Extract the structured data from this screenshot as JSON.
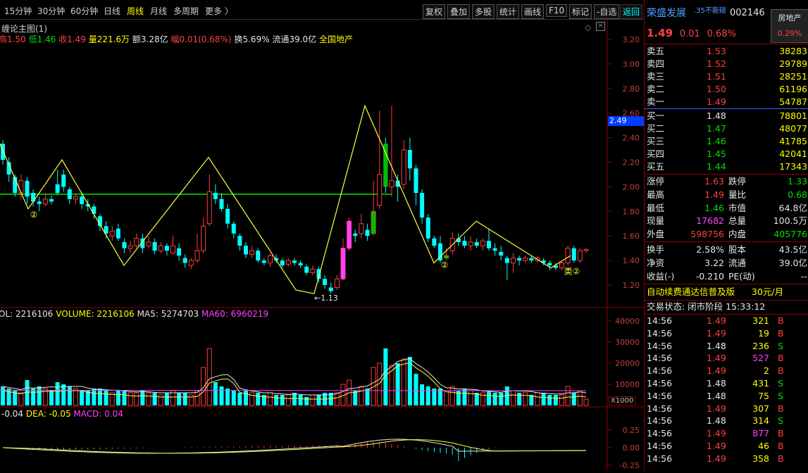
{
  "toolbar": {
    "periods": [
      "15分钟",
      "30分钟",
      "60分钟",
      "日线",
      "周线",
      "月线",
      "多周期",
      "更多 〉"
    ],
    "selected_period": "周线",
    "buttons": [
      "复权",
      "叠加",
      "多股",
      "统计",
      "画线",
      "F10",
      "标记",
      "-自选",
      "返回"
    ]
  },
  "main_chart": {
    "title": "缠论主图(1)",
    "stats": {
      "high": "高1.50",
      "low": "低1.46",
      "close": "收1.49",
      "volume": "量221.6万",
      "amount": "额3.28亿",
      "change": "幅0.01(0.68%)",
      "turnover": "换5.69%",
      "float": "流通39.0亿",
      "sector": "全国地产"
    },
    "price_axis": [
      "3.20",
      "3.00",
      "2.80",
      "2.60",
      "2.40",
      "2.20",
      "2.00",
      "1.80",
      "1.60",
      "1.40",
      "1.20"
    ],
    "current_price_tag": "2.49",
    "low_label": "1.13",
    "markers": [
      "②",
      "②",
      "②",
      "类②"
    ]
  },
  "volume_chart": {
    "legend": {
      "vol": "OL: 2216106",
      "volume": "VOLUME: 2216106",
      "ma5": "MA5: 5274703",
      "ma60": "MA60: 6960219"
    },
    "axis": [
      "40000",
      "30000",
      "20000",
      "10000"
    ],
    "unit": "X1000"
  },
  "macd_chart": {
    "legend": {
      "dif": "-0.04",
      "dea": "DEA: -0.05",
      "macd": "MACD: 0.04"
    },
    "axis": [
      "0.25",
      "0.00",
      "-0.25"
    ]
  },
  "stock": {
    "name": "荣盛发展",
    "tag": ".35不能碰",
    "code": "002146",
    "sector": "房地产",
    "price": "1.49",
    "change": "0.01",
    "change_pct": "0.68%",
    "sector_pct": "0.29%"
  },
  "order_book": {
    "asks": [
      {
        "label": "卖五",
        "price": "1.53",
        "vol": "38283"
      },
      {
        "label": "卖四",
        "price": "1.52",
        "vol": "29789"
      },
      {
        "label": "卖三",
        "price": "1.51",
        "vol": "28251"
      },
      {
        "label": "卖二",
        "price": "1.50",
        "vol": "61196"
      },
      {
        "label": "卖一",
        "price": "1.49",
        "vol": "54787"
      }
    ],
    "bids": [
      {
        "label": "买一",
        "price": "1.48",
        "vol": "78801"
      },
      {
        "label": "买二",
        "price": "1.47",
        "vol": "48077"
      },
      {
        "label": "买三",
        "price": "1.46",
        "vol": "41785"
      },
      {
        "label": "买四",
        "price": "1.45",
        "vol": "42041"
      },
      {
        "label": "买五",
        "price": "1.44",
        "vol": "17343"
      }
    ]
  },
  "quote": [
    {
      "l1": "涨停",
      "v1": "1.63",
      "l2": "跌停",
      "v2": "1.33",
      "c1": "red",
      "c2": "green"
    },
    {
      "l1": "最高",
      "v1": "1.49",
      "l2": "量比",
      "v2": "0.68",
      "c1": "red",
      "c2": "green"
    },
    {
      "l1": "最低",
      "v1": "1.46",
      "l2": "市值",
      "v2": "64.8亿",
      "c1": "green",
      "c2": "white"
    },
    {
      "l1": "现量",
      "v1": "17682",
      "l2": "总量",
      "v2": "100.5万",
      "c1": "mag",
      "c2": "white"
    },
    {
      "l1": "外盘",
      "v1": "598756",
      "l2": "内盘",
      "v2": "405776",
      "c1": "red",
      "c2": "green"
    }
  ],
  "quote2": [
    {
      "l1": "换手",
      "v1": "2.58%",
      "l2": "股本",
      "v2": "43.5亿"
    },
    {
      "l1": "净资",
      "v1": "3.22",
      "l2": "流通",
      "v2": "39.0亿"
    },
    {
      "l1": "收益(-)",
      "v1": "-0.210",
      "l2": "PE(动)",
      "v2": "--"
    }
  ],
  "promo": {
    "text": "自动续费通达信普及版",
    "price": "30元/月"
  },
  "trade_status": "交易状态: 闭市阶段 15:33:12",
  "ticks": [
    {
      "t": "14:56",
      "p": "1.49",
      "v": "321",
      "s": "B",
      "pc": "red",
      "vc": "yellow"
    },
    {
      "t": "14:56",
      "p": "1.49",
      "v": "19",
      "s": "B",
      "pc": "red",
      "vc": "yellow"
    },
    {
      "t": "14:56",
      "p": "1.48",
      "v": "236",
      "s": "S",
      "pc": "white",
      "vc": "yellow"
    },
    {
      "t": "14:56",
      "p": "1.49",
      "v": "527",
      "s": "B",
      "pc": "red",
      "vc": "mag"
    },
    {
      "t": "14:56",
      "p": "1.49",
      "v": "2",
      "s": "B",
      "pc": "red",
      "vc": "yellow"
    },
    {
      "t": "14:56",
      "p": "1.48",
      "v": "431",
      "s": "S",
      "pc": "white",
      "vc": "yellow"
    },
    {
      "t": "14:56",
      "p": "1.48",
      "v": "75",
      "s": "S",
      "pc": "white",
      "vc": "yellow"
    },
    {
      "t": "14:56",
      "p": "1.49",
      "v": "307",
      "s": "B",
      "pc": "red",
      "vc": "yellow"
    },
    {
      "t": "14:56",
      "p": "1.48",
      "v": "314",
      "s": "S",
      "pc": "white",
      "vc": "yellow"
    },
    {
      "t": "14:56",
      "p": "1.49",
      "v": "877",
      "s": "B",
      "pc": "red",
      "vc": "mag"
    },
    {
      "t": "14:56",
      "p": "1.49",
      "v": "46",
      "s": "B",
      "pc": "red",
      "vc": "yellow"
    },
    {
      "t": "14:56",
      "p": "1.49",
      "v": "358",
      "s": "B",
      "pc": "red",
      "vc": "yellow"
    }
  ],
  "colors": {
    "up": "#ff3c3c",
    "down": "#00ffff",
    "hub": "#00b000",
    "zigzag": "#ffff40",
    "ma60": "#ff40ff",
    "axis": "#8b0000"
  }
}
